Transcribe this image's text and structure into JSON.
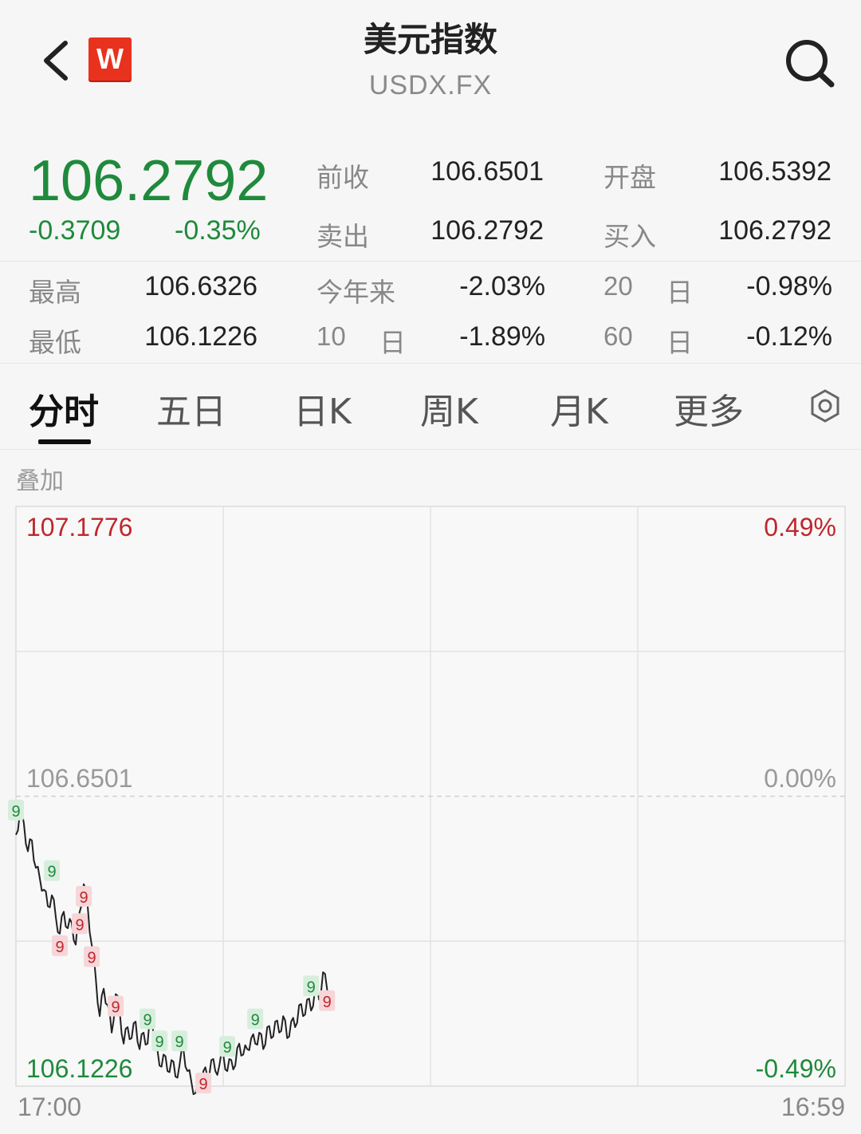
{
  "header": {
    "title": "美元指数",
    "subtitle": "USDX.FX",
    "logo_letter": "W"
  },
  "quote": {
    "price": "106.2792",
    "change": "-0.3709",
    "change_pct": "-0.35%",
    "prev_close_label": "前收",
    "prev_close": "106.6501",
    "open_label": "开盘",
    "open": "106.5392",
    "ask_label": "卖出",
    "ask": "106.2792",
    "bid_label": "买入",
    "bid": "106.2792"
  },
  "stats": {
    "high_label": "最高",
    "high": "106.6326",
    "low_label": "最低",
    "low": "106.1226",
    "ytd_label": "今年来",
    "ytd": "-2.03%",
    "d10_num": "10",
    "d10_unit": "日",
    "d10": "-1.89%",
    "d20_num": "20",
    "d20_unit": "日",
    "d20": "-0.98%",
    "d60_num": "60",
    "d60_unit": "日",
    "d60": "-0.12%"
  },
  "tabs": [
    {
      "label": "分时",
      "active": true
    },
    {
      "label": "五日",
      "active": false
    },
    {
      "label": "日K",
      "active": false
    },
    {
      "label": "周K",
      "active": false
    },
    {
      "label": "月K",
      "active": false
    },
    {
      "label": "更多",
      "active": false
    }
  ],
  "overlay_label": "叠加",
  "colors": {
    "up": "#c0262d",
    "down": "#1f8a3c",
    "neutral": "#999999",
    "line": "#222222"
  },
  "chart_data": {
    "type": "line",
    "y_left_labels": {
      "top": "107.1776",
      "mid": "106.6501",
      "bottom": "106.1226"
    },
    "y_right_labels": {
      "top": "0.49%",
      "mid": "0.00%",
      "bottom": "-0.49%"
    },
    "x_labels": {
      "start": "17:00",
      "end": "16:59"
    },
    "ylim": [
      106.1226,
      107.1776
    ],
    "baseline": 106.6501,
    "session_fraction_shown": 0.38,
    "series": [
      {
        "values": [
          106.58,
          106.62,
          106.6,
          106.55,
          106.57,
          106.52,
          106.5,
          106.48,
          106.45,
          106.47,
          106.43,
          106.4,
          106.44,
          106.41,
          106.42,
          106.38,
          106.44,
          106.49,
          106.45,
          106.38,
          106.32,
          106.25,
          106.3,
          106.27,
          106.22,
          106.29,
          106.26,
          106.2,
          106.23,
          106.21,
          106.24,
          106.19,
          106.22,
          106.2,
          106.26,
          106.19,
          106.16,
          106.18,
          106.15,
          106.17,
          106.14,
          106.16,
          106.19,
          106.15,
          106.13,
          106.11,
          106.12,
          106.15,
          106.14,
          106.17,
          106.15,
          106.16,
          106.18,
          106.15,
          106.17,
          106.16,
          106.2,
          106.18,
          106.19,
          106.21,
          106.2,
          106.22,
          106.19,
          106.23,
          106.21,
          106.24,
          106.22,
          106.25,
          106.21,
          106.24,
          106.23,
          106.27,
          106.25,
          106.28,
          106.26,
          106.3,
          106.28,
          106.33,
          106.3,
          106.26
        ]
      }
    ],
    "td_markers": [
      {
        "label": "9",
        "index": 0,
        "type": "up"
      },
      {
        "label": "9",
        "index": 9,
        "type": "up"
      },
      {
        "label": "9",
        "index": 11,
        "type": "down"
      },
      {
        "label": "9",
        "index": 16,
        "type": "down"
      },
      {
        "label": "9",
        "index": 17,
        "type": "down"
      },
      {
        "label": "9",
        "index": 19,
        "type": "down"
      },
      {
        "label": "9",
        "index": 25,
        "type": "down"
      },
      {
        "label": "9",
        "index": 33,
        "type": "up"
      },
      {
        "label": "9",
        "index": 36,
        "type": "up"
      },
      {
        "label": "9",
        "index": 41,
        "type": "up"
      },
      {
        "label": "9",
        "index": 47,
        "type": "down"
      },
      {
        "label": "9",
        "index": 53,
        "type": "up"
      },
      {
        "label": "9",
        "index": 60,
        "type": "up"
      },
      {
        "label": "9",
        "index": 74,
        "type": "up"
      },
      {
        "label": "9",
        "index": 78,
        "type": "down"
      }
    ]
  }
}
